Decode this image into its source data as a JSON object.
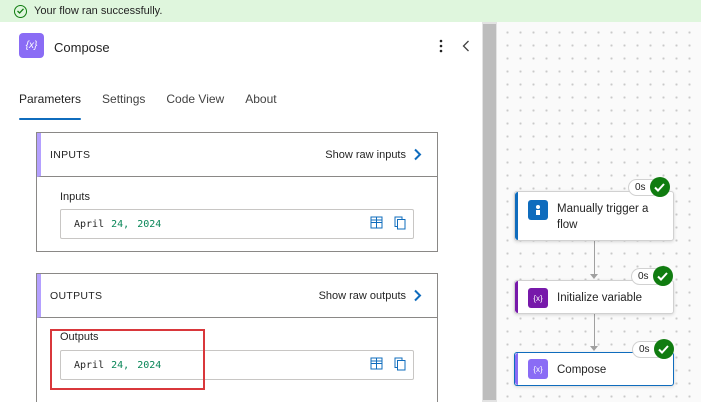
{
  "banner": {
    "message": "Your flow ran successfully.",
    "icon": "check-circle-icon"
  },
  "header": {
    "title": "Compose",
    "icon_text": "{x}",
    "more_icon": "more-vertical-icon",
    "collapse_icon": "chevron-left-icon"
  },
  "tabs": [
    {
      "label": "Parameters",
      "active": true
    },
    {
      "label": "Settings",
      "active": false
    },
    {
      "label": "Code View",
      "active": false
    },
    {
      "label": "About",
      "active": false
    }
  ],
  "inputs_section": {
    "title": "INPUTS",
    "raw_link": "Show raw inputs",
    "field_label": "Inputs",
    "value": {
      "month": "April",
      "day": "24,",
      "year": "2024"
    }
  },
  "outputs_section": {
    "title": "OUTPUTS",
    "raw_link": "Show raw outputs",
    "field_label": "Outputs",
    "value": {
      "month": "April",
      "day": "24,",
      "year": "2024"
    }
  },
  "flow": {
    "nodes": [
      {
        "line1": "Manually trigger a",
        "line2": "flow",
        "icon_color": "#0f6cbd",
        "bar_color": "#0f6cbd",
        "duration": "0s"
      },
      {
        "label": "Initialize variable",
        "icon_text": "{x}",
        "icon_color": "#7719aa",
        "bar_color": "#7719aa",
        "duration": "0s"
      },
      {
        "label": "Compose",
        "icon_text": "{x}",
        "icon_color": "#8a6cf5",
        "bar_color": "#8a6cf5",
        "duration": "0s"
      }
    ]
  },
  "colors": {
    "accent": "#0f6cbd",
    "success": "#107c10",
    "highlight": "#d9373b"
  }
}
